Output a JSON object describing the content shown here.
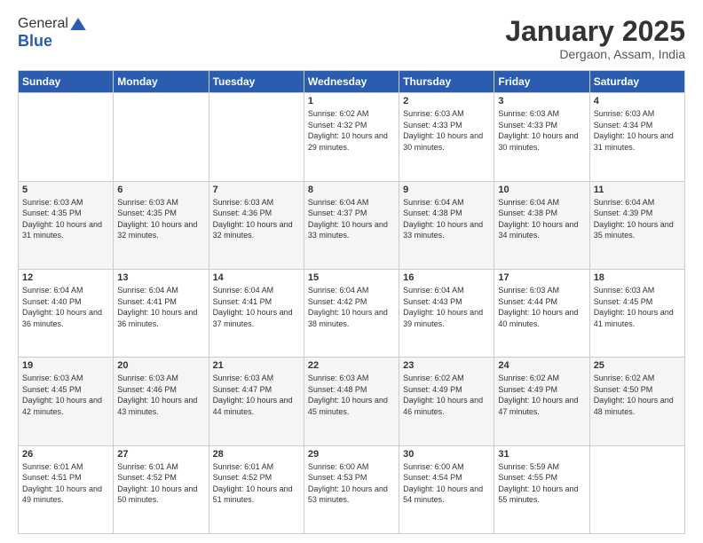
{
  "header": {
    "logo_general": "General",
    "logo_blue": "Blue",
    "title": "January 2025",
    "subtitle": "Dergaon, Assam, India"
  },
  "days_of_week": [
    "Sunday",
    "Monday",
    "Tuesday",
    "Wednesday",
    "Thursday",
    "Friday",
    "Saturday"
  ],
  "weeks": [
    [
      {
        "day": "",
        "sunrise": "",
        "sunset": "",
        "daylight": ""
      },
      {
        "day": "",
        "sunrise": "",
        "sunset": "",
        "daylight": ""
      },
      {
        "day": "",
        "sunrise": "",
        "sunset": "",
        "daylight": ""
      },
      {
        "day": "1",
        "sunrise": "Sunrise: 6:02 AM",
        "sunset": "Sunset: 4:32 PM",
        "daylight": "Daylight: 10 hours and 29 minutes."
      },
      {
        "day": "2",
        "sunrise": "Sunrise: 6:03 AM",
        "sunset": "Sunset: 4:33 PM",
        "daylight": "Daylight: 10 hours and 30 minutes."
      },
      {
        "day": "3",
        "sunrise": "Sunrise: 6:03 AM",
        "sunset": "Sunset: 4:33 PM",
        "daylight": "Daylight: 10 hours and 30 minutes."
      },
      {
        "day": "4",
        "sunrise": "Sunrise: 6:03 AM",
        "sunset": "Sunset: 4:34 PM",
        "daylight": "Daylight: 10 hours and 31 minutes."
      }
    ],
    [
      {
        "day": "5",
        "sunrise": "Sunrise: 6:03 AM",
        "sunset": "Sunset: 4:35 PM",
        "daylight": "Daylight: 10 hours and 31 minutes."
      },
      {
        "day": "6",
        "sunrise": "Sunrise: 6:03 AM",
        "sunset": "Sunset: 4:35 PM",
        "daylight": "Daylight: 10 hours and 32 minutes."
      },
      {
        "day": "7",
        "sunrise": "Sunrise: 6:03 AM",
        "sunset": "Sunset: 4:36 PM",
        "daylight": "Daylight: 10 hours and 32 minutes."
      },
      {
        "day": "8",
        "sunrise": "Sunrise: 6:04 AM",
        "sunset": "Sunset: 4:37 PM",
        "daylight": "Daylight: 10 hours and 33 minutes."
      },
      {
        "day": "9",
        "sunrise": "Sunrise: 6:04 AM",
        "sunset": "Sunset: 4:38 PM",
        "daylight": "Daylight: 10 hours and 33 minutes."
      },
      {
        "day": "10",
        "sunrise": "Sunrise: 6:04 AM",
        "sunset": "Sunset: 4:38 PM",
        "daylight": "Daylight: 10 hours and 34 minutes."
      },
      {
        "day": "11",
        "sunrise": "Sunrise: 6:04 AM",
        "sunset": "Sunset: 4:39 PM",
        "daylight": "Daylight: 10 hours and 35 minutes."
      }
    ],
    [
      {
        "day": "12",
        "sunrise": "Sunrise: 6:04 AM",
        "sunset": "Sunset: 4:40 PM",
        "daylight": "Daylight: 10 hours and 36 minutes."
      },
      {
        "day": "13",
        "sunrise": "Sunrise: 6:04 AM",
        "sunset": "Sunset: 4:41 PM",
        "daylight": "Daylight: 10 hours and 36 minutes."
      },
      {
        "day": "14",
        "sunrise": "Sunrise: 6:04 AM",
        "sunset": "Sunset: 4:41 PM",
        "daylight": "Daylight: 10 hours and 37 minutes."
      },
      {
        "day": "15",
        "sunrise": "Sunrise: 6:04 AM",
        "sunset": "Sunset: 4:42 PM",
        "daylight": "Daylight: 10 hours and 38 minutes."
      },
      {
        "day": "16",
        "sunrise": "Sunrise: 6:04 AM",
        "sunset": "Sunset: 4:43 PM",
        "daylight": "Daylight: 10 hours and 39 minutes."
      },
      {
        "day": "17",
        "sunrise": "Sunrise: 6:03 AM",
        "sunset": "Sunset: 4:44 PM",
        "daylight": "Daylight: 10 hours and 40 minutes."
      },
      {
        "day": "18",
        "sunrise": "Sunrise: 6:03 AM",
        "sunset": "Sunset: 4:45 PM",
        "daylight": "Daylight: 10 hours and 41 minutes."
      }
    ],
    [
      {
        "day": "19",
        "sunrise": "Sunrise: 6:03 AM",
        "sunset": "Sunset: 4:45 PM",
        "daylight": "Daylight: 10 hours and 42 minutes."
      },
      {
        "day": "20",
        "sunrise": "Sunrise: 6:03 AM",
        "sunset": "Sunset: 4:46 PM",
        "daylight": "Daylight: 10 hours and 43 minutes."
      },
      {
        "day": "21",
        "sunrise": "Sunrise: 6:03 AM",
        "sunset": "Sunset: 4:47 PM",
        "daylight": "Daylight: 10 hours and 44 minutes."
      },
      {
        "day": "22",
        "sunrise": "Sunrise: 6:03 AM",
        "sunset": "Sunset: 4:48 PM",
        "daylight": "Daylight: 10 hours and 45 minutes."
      },
      {
        "day": "23",
        "sunrise": "Sunrise: 6:02 AM",
        "sunset": "Sunset: 4:49 PM",
        "daylight": "Daylight: 10 hours and 46 minutes."
      },
      {
        "day": "24",
        "sunrise": "Sunrise: 6:02 AM",
        "sunset": "Sunset: 4:49 PM",
        "daylight": "Daylight: 10 hours and 47 minutes."
      },
      {
        "day": "25",
        "sunrise": "Sunrise: 6:02 AM",
        "sunset": "Sunset: 4:50 PM",
        "daylight": "Daylight: 10 hours and 48 minutes."
      }
    ],
    [
      {
        "day": "26",
        "sunrise": "Sunrise: 6:01 AM",
        "sunset": "Sunset: 4:51 PM",
        "daylight": "Daylight: 10 hours and 49 minutes."
      },
      {
        "day": "27",
        "sunrise": "Sunrise: 6:01 AM",
        "sunset": "Sunset: 4:52 PM",
        "daylight": "Daylight: 10 hours and 50 minutes."
      },
      {
        "day": "28",
        "sunrise": "Sunrise: 6:01 AM",
        "sunset": "Sunset: 4:52 PM",
        "daylight": "Daylight: 10 hours and 51 minutes."
      },
      {
        "day": "29",
        "sunrise": "Sunrise: 6:00 AM",
        "sunset": "Sunset: 4:53 PM",
        "daylight": "Daylight: 10 hours and 53 minutes."
      },
      {
        "day": "30",
        "sunrise": "Sunrise: 6:00 AM",
        "sunset": "Sunset: 4:54 PM",
        "daylight": "Daylight: 10 hours and 54 minutes."
      },
      {
        "day": "31",
        "sunrise": "Sunrise: 5:59 AM",
        "sunset": "Sunset: 4:55 PM",
        "daylight": "Daylight: 10 hours and 55 minutes."
      },
      {
        "day": "",
        "sunrise": "",
        "sunset": "",
        "daylight": ""
      }
    ]
  ]
}
